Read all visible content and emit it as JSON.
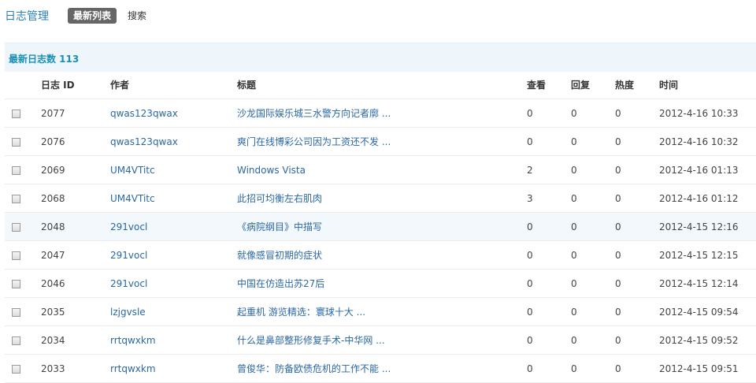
{
  "nav": {
    "title": "日志管理",
    "tabs": [
      {
        "label": "最新列表",
        "active": true
      },
      {
        "label": "搜索",
        "active": false
      }
    ]
  },
  "panel": {
    "count_label": "最新日志数 113"
  },
  "table": {
    "headers": {
      "id": "日志 ID",
      "author": "作者",
      "title": "标题",
      "views": "查看",
      "replies": "回复",
      "heat": "热度",
      "time": "时间"
    },
    "rows": [
      {
        "id": "2077",
        "author": "qwas123qwax",
        "title": "沙龙国际娱乐城三水警方向记者廓 ...",
        "views": "0",
        "replies": "0",
        "heat": "0",
        "time": "2012-4-16 10:33"
      },
      {
        "id": "2076",
        "author": "qwas123qwax",
        "title": "爽门在线博彩公司因为工资还不发 ...",
        "views": "0",
        "replies": "0",
        "heat": "0",
        "time": "2012-4-16 10:32"
      },
      {
        "id": "2069",
        "author": "UM4VTitc",
        "title": "Windows Vista",
        "views": "2",
        "replies": "0",
        "heat": "0",
        "time": "2012-4-16 01:13"
      },
      {
        "id": "2068",
        "author": "UM4VTitc",
        "title": "此招可均衡左右肌肉",
        "views": "3",
        "replies": "0",
        "heat": "0",
        "time": "2012-4-16 01:12"
      },
      {
        "id": "2048",
        "author": "291vocl",
        "title": "《病院纲目》中描写",
        "views": "0",
        "replies": "0",
        "heat": "0",
        "time": "2012-4-15 12:16"
      },
      {
        "id": "2047",
        "author": "291vocl",
        "title": "就像感冒初期的症状",
        "views": "0",
        "replies": "0",
        "heat": "0",
        "time": "2012-4-15 12:15"
      },
      {
        "id": "2046",
        "author": "291vocl",
        "title": "中国在仿造出苏27后",
        "views": "0",
        "replies": "0",
        "heat": "0",
        "time": "2012-4-15 12:14"
      },
      {
        "id": "2035",
        "author": "lzjgvsle",
        "title": "起重机 游览精选：寰球十大 ...",
        "views": "0",
        "replies": "0",
        "heat": "0",
        "time": "2012-4-15 09:54"
      },
      {
        "id": "2034",
        "author": "rrtqwxkm",
        "title": "什么是鼻部整形修复手术-中华网 ...",
        "views": "0",
        "replies": "0",
        "heat": "0",
        "time": "2012-4-15 09:52"
      },
      {
        "id": "2033",
        "author": "rrtqwxkm",
        "title": "曾俊华：防备欧债危机的工作不能 ...",
        "views": "0",
        "replies": "0",
        "heat": "0",
        "time": "2012-4-15 09:51"
      }
    ]
  }
}
